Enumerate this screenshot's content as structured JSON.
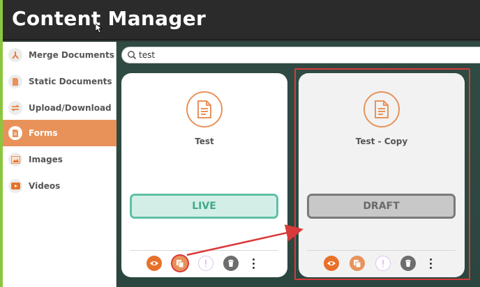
{
  "app": {
    "title": "Content Manager"
  },
  "search": {
    "value": "test"
  },
  "sidebar": {
    "items": [
      {
        "label": "Merge Documents",
        "icon": "merge-icon"
      },
      {
        "label": "Static Documents",
        "icon": "document-icon"
      },
      {
        "label": "Upload/Download",
        "icon": "transfer-icon"
      },
      {
        "label": "Forms",
        "icon": "form-icon",
        "active": true
      },
      {
        "label": "Images",
        "icon": "image-icon"
      },
      {
        "label": "Videos",
        "icon": "video-icon"
      }
    ]
  },
  "cards": [
    {
      "title": "Test",
      "status": "LIVE"
    },
    {
      "title": "Test - Copy",
      "status": "DRAFT"
    }
  ],
  "colors": {
    "accent": "#e8925a",
    "live": "#5fc0a6",
    "draft": "#7a7a7a",
    "highlight": "#d93a3a",
    "lime": "#8cc63f"
  }
}
